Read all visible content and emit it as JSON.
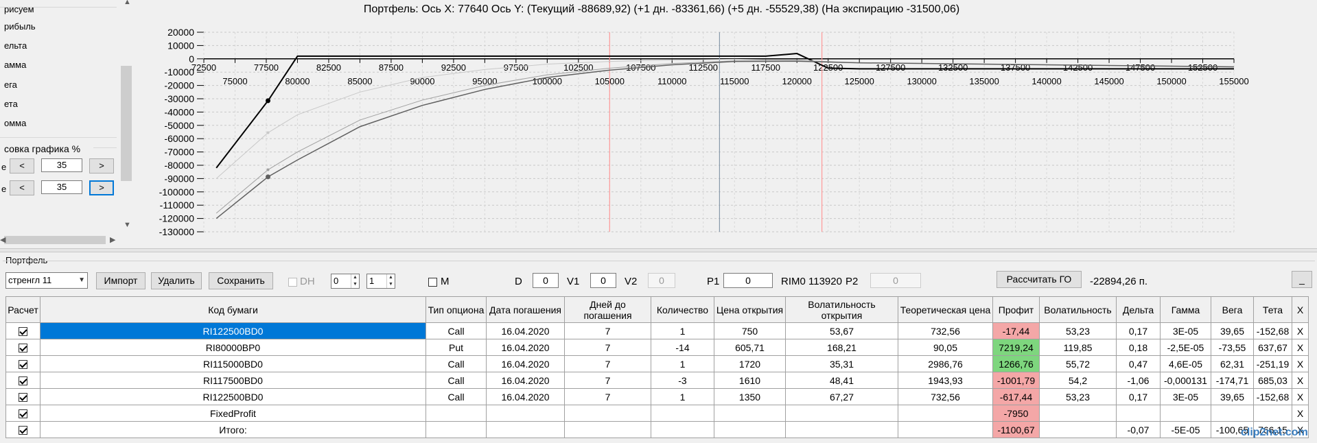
{
  "left_panel": {
    "header": "рисуем",
    "items": [
      "рибыль",
      "ельта",
      "амма",
      "ега",
      "ета",
      "омма"
    ],
    "zoom_label": "совка графика %",
    "row1": {
      "left": "<",
      "value": "35",
      "right": ">",
      "prefix": "е"
    },
    "row2": {
      "left": "<",
      "value": "35",
      "right": ">",
      "prefix": "е"
    }
  },
  "chart": {
    "title": "Портфель: Ось X: 77640 Ось Y:  (Текущий -88689,92)  (+1 дн. -83361,66)  (+5 дн. -55529,38)  (На экспирацию -31500,06)"
  },
  "chart_data": {
    "type": "line",
    "y_ticks": [
      20000,
      10000,
      0,
      -10000,
      -20000,
      -30000,
      -40000,
      -50000,
      -60000,
      -70000,
      -80000,
      -90000,
      -100000,
      -110000,
      -120000,
      -130000
    ],
    "x_ticks_top": [
      72500,
      77500,
      82500,
      87500,
      92500,
      97500,
      102500,
      107500,
      112500,
      117500,
      122500,
      127500,
      132500,
      137500,
      142500,
      147500,
      152500
    ],
    "x_ticks_bottom": [
      75000,
      80000,
      85000,
      90000,
      95000,
      100000,
      105000,
      110000,
      115000,
      120000,
      125000,
      130000,
      135000,
      140000,
      145000,
      150000,
      155000
    ],
    "xlim": [
      72500,
      155000
    ],
    "ylim": [
      -130000,
      20000
    ],
    "grid": true,
    "vlines": [
      {
        "x": 105000,
        "color": "#ff9999"
      },
      {
        "x": 113800,
        "color": "#8899aa"
      },
      {
        "x": 122000,
        "color": "#ff9999"
      }
    ],
    "series": [
      {
        "id": "expiry",
        "color": "#000000",
        "width": 2,
        "x": [
          73500,
          77640,
          80000,
          117500,
          120000,
          122500,
          125000,
          155000
        ],
        "y": [
          -82000,
          -31500,
          2000,
          2000,
          4000,
          -7000,
          -7500,
          -7500
        ]
      },
      {
        "id": "plus5",
        "color": "#c8c8c8",
        "width": 1,
        "x": [
          73500,
          77640,
          80000,
          85000,
          90000,
          95000,
          100000,
          105000,
          110000,
          115000,
          120000,
          125000,
          155000
        ],
        "y": [
          -90000,
          -55529,
          -42000,
          -25000,
          -14000,
          -8000,
          -4000,
          -2000,
          -800,
          -300,
          -1000,
          -3000,
          -6000
        ]
      },
      {
        "id": "plus1",
        "color": "#a0a0a0",
        "width": 1,
        "x": [
          73500,
          77640,
          80000,
          85000,
          90000,
          95000,
          100000,
          105000,
          110000,
          115000,
          120000,
          125000,
          155000
        ],
        "y": [
          -116000,
          -83361,
          -70000,
          -46000,
          -31000,
          -20000,
          -12000,
          -7000,
          -3500,
          -1500,
          -1500,
          -3000,
          -6000
        ]
      },
      {
        "id": "current",
        "color": "#606060",
        "width": 1.5,
        "x": [
          73500,
          77640,
          80000,
          85000,
          90000,
          95000,
          100000,
          105000,
          110000,
          115000,
          120000,
          125000,
          155000
        ],
        "y": [
          -120000,
          -88689,
          -76000,
          -51000,
          -35000,
          -23000,
          -14000,
          -8500,
          -4500,
          -2000,
          -1800,
          -3000,
          -6000
        ]
      }
    ]
  },
  "portfolio": {
    "label": "Портфель",
    "combo_value": "стренгл 11",
    "import": "Импорт",
    "delete": "Удалить",
    "save": "Сохранить",
    "dh": "DH",
    "spin1": "0",
    "spin2": "1",
    "m": "M",
    "d_label": "D",
    "d_value": "0",
    "v1_label": "V1",
    "v1_value": "0",
    "v2_label": "V2",
    "v2_value": "0",
    "p1_label": "P1",
    "p1_value": "0",
    "rim": "RIM0 113920",
    "p2_label": "P2",
    "p2_value": "0",
    "calc_go": "Рассчитать ГО",
    "go_value": "-22894,26 п.",
    "minimize": "_"
  },
  "table": {
    "headers": [
      "Расчет",
      "Код бумаги",
      "Тип опциона",
      "Дата погашения",
      "Дней до погашения",
      "Количество",
      "Цена открытия",
      "Волатильность открытия",
      "Теоретическая цена",
      "Профит",
      "Волатильность",
      "Дельта",
      "Гамма",
      "Вега",
      "Тета",
      "X"
    ],
    "rows": [
      [
        "",
        "RI122500BD0",
        "Call",
        "16.04.2020",
        "7",
        "1",
        "750",
        "53,67",
        "732,56",
        "-17,44",
        "53,23",
        "0,17",
        "3E-05",
        "39,65",
        "-152,68",
        "X"
      ],
      [
        "",
        "RI80000BP0",
        "Put",
        "16.04.2020",
        "7",
        "-14",
        "605,71",
        "168,21",
        "90,05",
        "7219,24",
        "119,85",
        "0,18",
        "-2,5E-05",
        "-73,55",
        "637,67",
        "X"
      ],
      [
        "",
        "RI115000BD0",
        "Call",
        "16.04.2020",
        "7",
        "1",
        "1720",
        "35,31",
        "2986,76",
        "1266,76",
        "55,72",
        "0,47",
        "4,6E-05",
        "62,31",
        "-251,19",
        "X"
      ],
      [
        "",
        "RI117500BD0",
        "Call",
        "16.04.2020",
        "7",
        "-3",
        "1610",
        "48,41",
        "1943,93",
        "-1001,79",
        "54,2",
        "-1,06",
        "-0,000131",
        "-174,71",
        "685,03",
        "X"
      ],
      [
        "",
        "RI122500BD0",
        "Call",
        "16.04.2020",
        "7",
        "1",
        "1350",
        "67,27",
        "732,56",
        "-617,44",
        "53,23",
        "0,17",
        "3E-05",
        "39,65",
        "-152,68",
        "X"
      ],
      [
        "",
        "FixedProfit",
        "",
        "",
        "",
        "",
        "",
        "",
        "",
        "-7950",
        "",
        "",
        "",
        "",
        "",
        "X"
      ],
      [
        "",
        "Итого:",
        "",
        "",
        "",
        "",
        "",
        "",
        "",
        "-1100,67",
        "",
        "-0,07",
        "-5E-05",
        "-100,65",
        "766,15",
        "X"
      ]
    ],
    "profit_status": [
      "neg",
      "pos",
      "pos",
      "neg",
      "neg",
      "neg",
      "neg"
    ]
  },
  "watermark": "clip2net.com"
}
